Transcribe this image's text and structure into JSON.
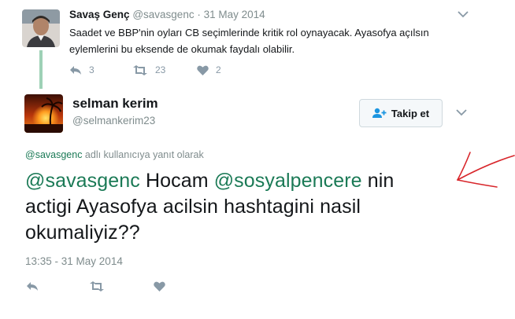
{
  "parent_tweet": {
    "author_name": "Savaş Genç",
    "author_handle": "@savasgenc",
    "separator": "·",
    "date": "31 May 2014",
    "text": "Saadet ve BBP'nin oyları CB seçimlerinde kritik rol oynayacak.  Ayasofya açılsın eylemlerini bu eksende de okumak faydalı olabilir.",
    "reply_count": "3",
    "retweet_count": "23",
    "like_count": "2",
    "icons": [
      "reply-icon",
      "retweet-icon",
      "heart-icon",
      "chevron-down-icon"
    ]
  },
  "main_tweet": {
    "author_name": "selman kerim",
    "author_handle": "@selmankerim23",
    "follow_label": "Takip et",
    "reply_to_handle": "@savasgenc",
    "reply_to_suffix": " adlı kullanıcıya yanıt olarak",
    "text_mention_1": "@savasgenc",
    "text_part_1": " Hocam ",
    "text_mention_2": "@sosyalpencere",
    "text_part_2": " nin actigi Ayasofya acilsin hashtagini nasil okumaliyiz??",
    "timestamp": "13:35 - 31 May 2014",
    "icons": [
      "reply-icon",
      "retweet-icon",
      "heart-icon",
      "chevron-down-icon",
      "follow-person-icon"
    ]
  },
  "colors": {
    "accent": "#1b7a56",
    "thread_line": "#9ed1b6",
    "muted": "#7f8c8d",
    "annotation_arrow": "#d8262b"
  }
}
